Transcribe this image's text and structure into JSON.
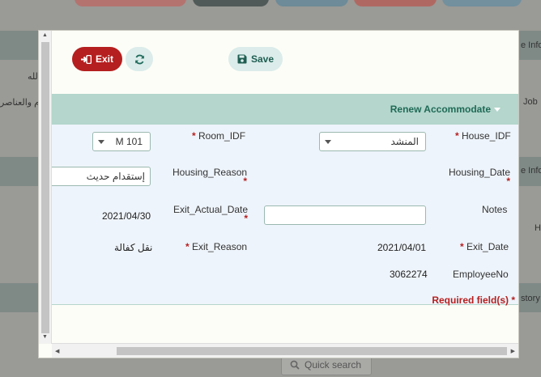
{
  "background": {
    "snippets": {
      "left_row1": "لله",
      "left_row2": "م والعناصر",
      "right_row1": "e Info",
      "right_row2": "Job",
      "right_row3": "e Info",
      "right_row4": "H",
      "right_row5": "story"
    },
    "search_label": "Quick search"
  },
  "toolbar": {
    "exit_label": "Exit",
    "save_label": "Save"
  },
  "section": {
    "title": "Renew Accommodate"
  },
  "form": {
    "house_idf": {
      "label": "House_IDF",
      "value": "المنشد"
    },
    "room_idf": {
      "label": "Room_IDF",
      "value": "M 101"
    },
    "housing_date": {
      "label": "Housing_Date",
      "value": ""
    },
    "housing_reason": {
      "label": "Housing_Reason",
      "value": "إستقدام حديث"
    },
    "notes": {
      "label": "Notes",
      "value": ""
    },
    "exit_actual_date": {
      "label": "Exit_Actual_Date",
      "value": "2021/04/30"
    },
    "exit_date": {
      "label": "Exit_Date",
      "value": "2021/04/01"
    },
    "exit_reason": {
      "label": "Exit_Reason",
      "value": "نقل كفالة"
    },
    "employee_no": {
      "label": "EmployeeNo",
      "value": "3062274"
    },
    "required_star": "*",
    "required_note": "Required field(s) *"
  },
  "colors": {
    "exit_button": "#b51f1f",
    "accent": "#1f6a56",
    "section_header": "#b4d6cc",
    "form_background": "#eef4fb"
  }
}
